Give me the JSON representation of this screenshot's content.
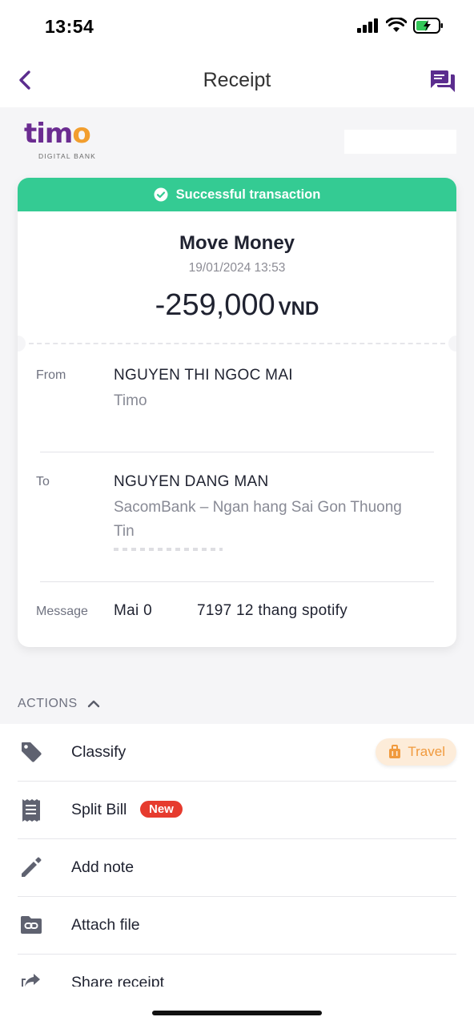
{
  "status_bar": {
    "time": "13:54"
  },
  "nav": {
    "title": "Receipt"
  },
  "brand": {
    "logo": "timo",
    "logo_sub": "DIGITAL BANK"
  },
  "card": {
    "status": "Successful transaction",
    "title": "Move Money",
    "datetime": "19/01/2024 13:53",
    "amount": "-259,000",
    "currency": "VND",
    "from": {
      "label": "From",
      "name": "NGUYEN THI NGOC MAI",
      "bank": "Timo"
    },
    "to": {
      "label": "To",
      "name": "NGUYEN DANG MAN",
      "bank": "SacomBank – Ngan hang Sai Gon Thuong Tin"
    },
    "message": {
      "label": "Message",
      "value_part1": "Mai 0",
      "value_part2": "7197 12 thang spotify"
    }
  },
  "actions": {
    "header": "ACTIONS",
    "items": [
      {
        "label": "Classify",
        "icon": "tag-icon",
        "tag": "Travel"
      },
      {
        "label": "Split Bill",
        "icon": "receipt-icon",
        "badge": "New"
      },
      {
        "label": "Add note",
        "icon": "pencil-icon"
      },
      {
        "label": "Attach file",
        "icon": "attach-folder-icon"
      },
      {
        "label": "Share receipt",
        "icon": "share-icon"
      }
    ]
  },
  "colors": {
    "accent": "#6b2c91",
    "success": "#34cb93",
    "badge": "#e63b2e",
    "tag": "#f09a3e"
  }
}
